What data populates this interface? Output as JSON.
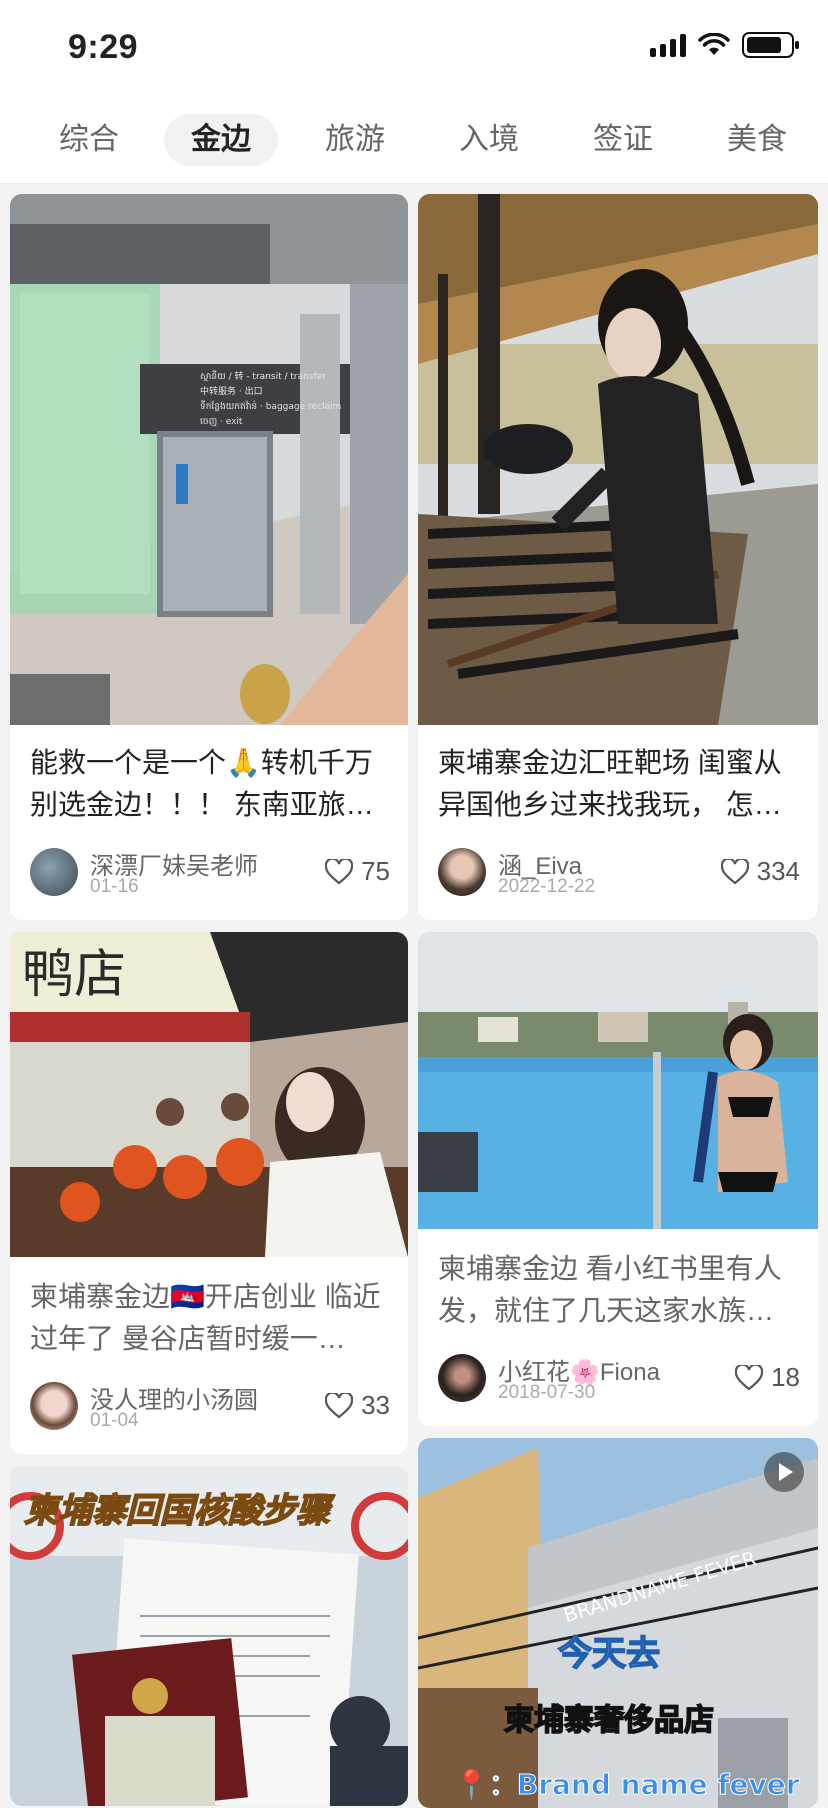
{
  "status_bar": {
    "time": "9:29"
  },
  "tabs": [
    {
      "label": "综合"
    },
    {
      "label": "金边"
    },
    {
      "label": "旅游"
    },
    {
      "label": "入境"
    },
    {
      "label": "签证"
    },
    {
      "label": "美食"
    }
  ],
  "active_tab": "金边",
  "posts": [
    {
      "title": "能救一个是一个🙏转机千万别选金边！！！ 东南亚旅…",
      "author": "深漂厂妹吴老师",
      "date": "01-16",
      "likes": "75",
      "image_signage": [
        "ស្ថានីយ / 转 - transit / transfer",
        "中转服务 · 出口",
        "ទីកន្លែងយកឥវ៉ាន់ · baggage reclaim",
        "ចេញ · exit"
      ]
    },
    {
      "title": "柬埔寨金边汇旺靶场 闺蜜从异国他乡过来找我玩， 怎…",
      "author": "涵_Eiva",
      "date": "2022-12-22",
      "likes": "334"
    },
    {
      "title": "柬埔寨金边🇰🇭开店创业 临近过年了 曼谷店暂时缓一…",
      "author": "没人理的小汤圆",
      "date": "01-04",
      "likes": "33",
      "image_text": "鸭店"
    },
    {
      "title": "柬埔寨金边 看小红书里有人发，就住了几天这家水族…",
      "author": "小红花🌸Fiona",
      "date": "2018-07-30",
      "likes": "18"
    },
    {
      "image_text": "柬埔寨回国核酸步骤"
    },
    {
      "image_text_1": "今天去",
      "image_text_2": "柬埔寨奢侈品店",
      "image_text_3": "📍：Brand name fever",
      "sign_text": "BRANDNAME FEVER"
    }
  ],
  "colors": {
    "accent_tab_bg": "#f2f2f2",
    "title_text": "#222222",
    "muted_text": "#666666"
  }
}
